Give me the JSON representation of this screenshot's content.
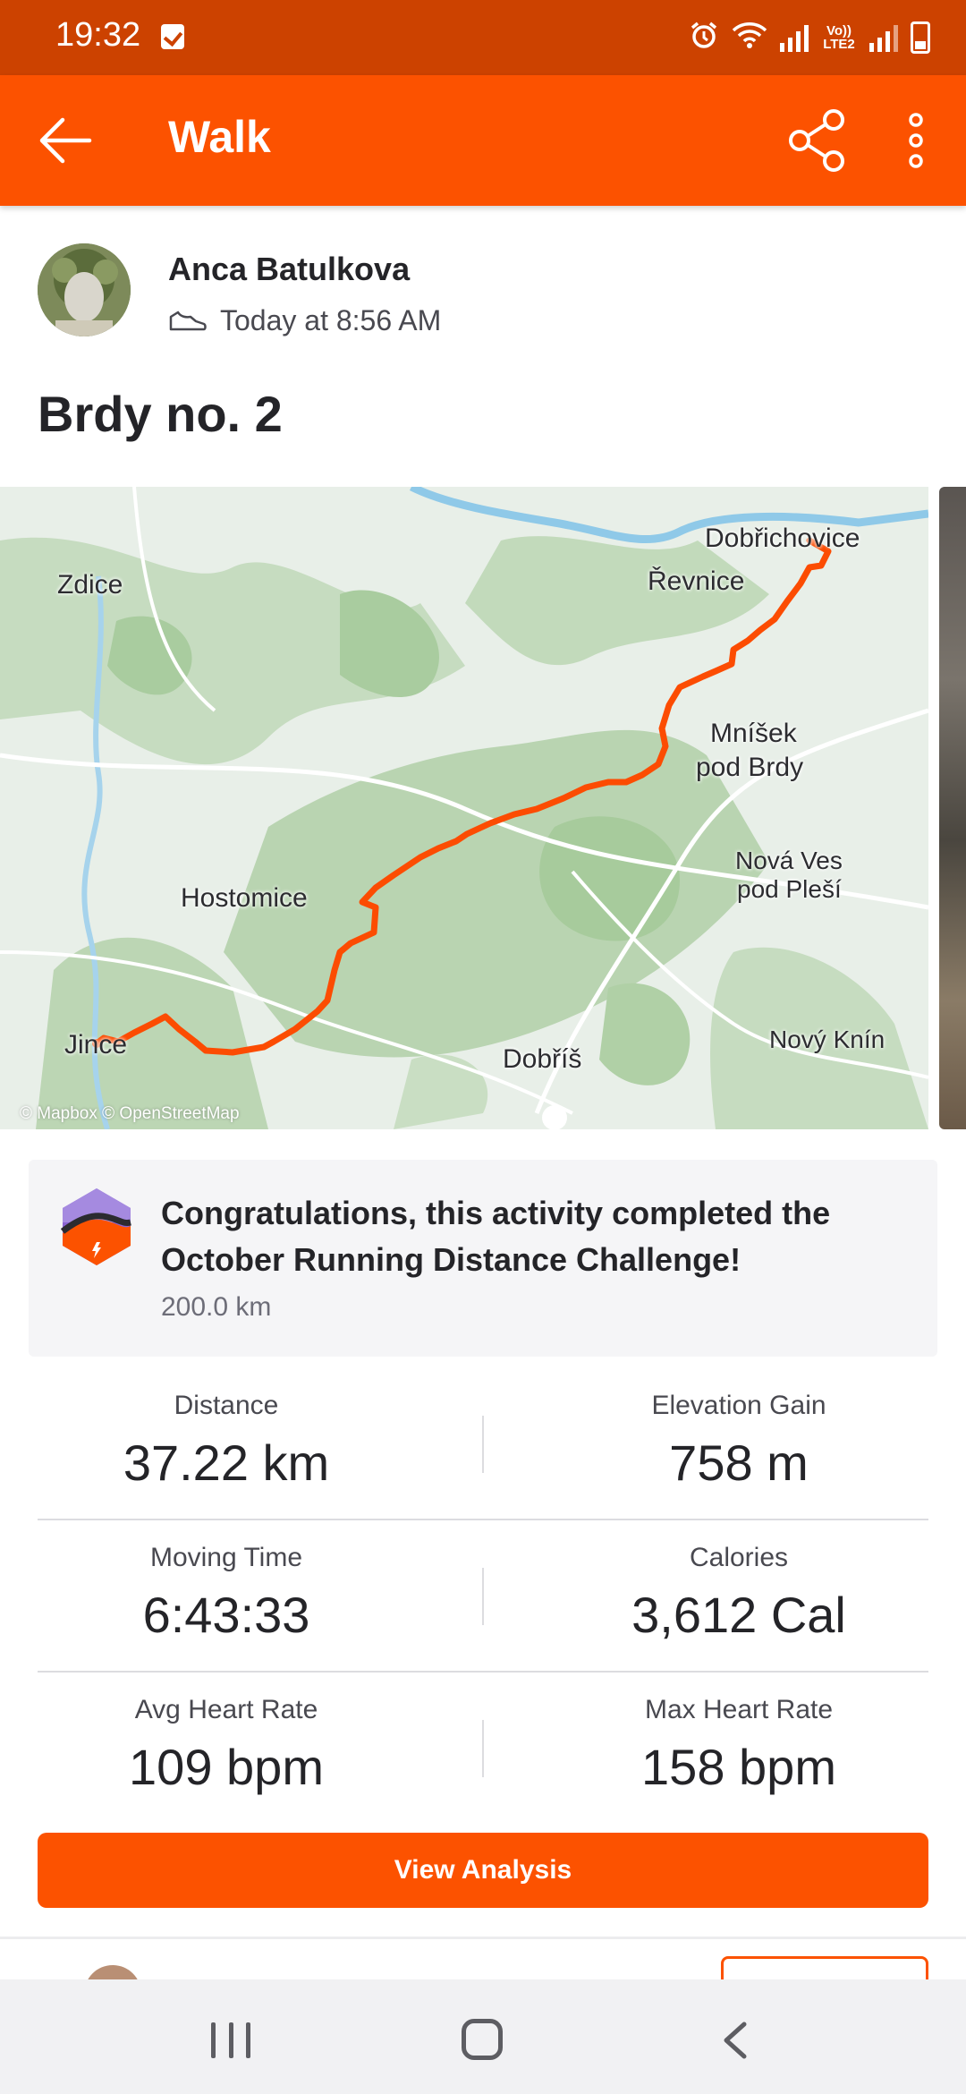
{
  "status_bar": {
    "time": "19:32",
    "icons": [
      "checkbox-icon",
      "alarm-icon",
      "wifi-icon",
      "signal-icon",
      "battery-icon"
    ],
    "lte_label": "Vo)) LTE2"
  },
  "app_bar": {
    "title": "Walk",
    "back_icon": "arrow-left-icon",
    "share_icon": "share-icon",
    "more_icon": "more-vertical-icon"
  },
  "athlete": {
    "name": "Anca Batulkova",
    "timestamp": "Today at 8:56 AM",
    "type_icon": "shoe-icon"
  },
  "activity": {
    "title": "Brdy no. 2"
  },
  "map": {
    "places": {
      "zdice": "Zdice",
      "dobrichovice": "Dobřichovice",
      "revnice": "Řevnice",
      "mnisek": "Mníšek",
      "mnisek2": "pod Brdy",
      "nova_ves": "Nová Ves",
      "nova_ves2": "pod Pleší",
      "hostomice": "Hostomice",
      "jince": "Jince",
      "dobris": "Dobříš",
      "novy_knin": "Nový Knín"
    },
    "attribution": "© Mapbox © OpenStreetMap",
    "route_color": "#fc4c02"
  },
  "challenge": {
    "message": "Congratulations, this activity completed the October Running Distance Challenge!",
    "goal": "200.0 km"
  },
  "stats": [
    {
      "label": "Distance",
      "value": "37.22 km"
    },
    {
      "label": "Elevation Gain",
      "value": "758 m"
    },
    {
      "label": "Moving Time",
      "value": "6:43:33"
    },
    {
      "label": "Calories",
      "value": "3,612 Cal"
    },
    {
      "label": "Avg Heart Rate",
      "value": "109 bpm"
    },
    {
      "label": "Max Heart Rate",
      "value": "158 bpm"
    }
  ],
  "actions": {
    "view_analysis": "View Analysis"
  },
  "nav_bar": {
    "recents": "recents-icon",
    "home": "home-icon",
    "back": "back-icon"
  },
  "colors": {
    "brand": "#fc5200",
    "status_bar": "#cc4200"
  }
}
